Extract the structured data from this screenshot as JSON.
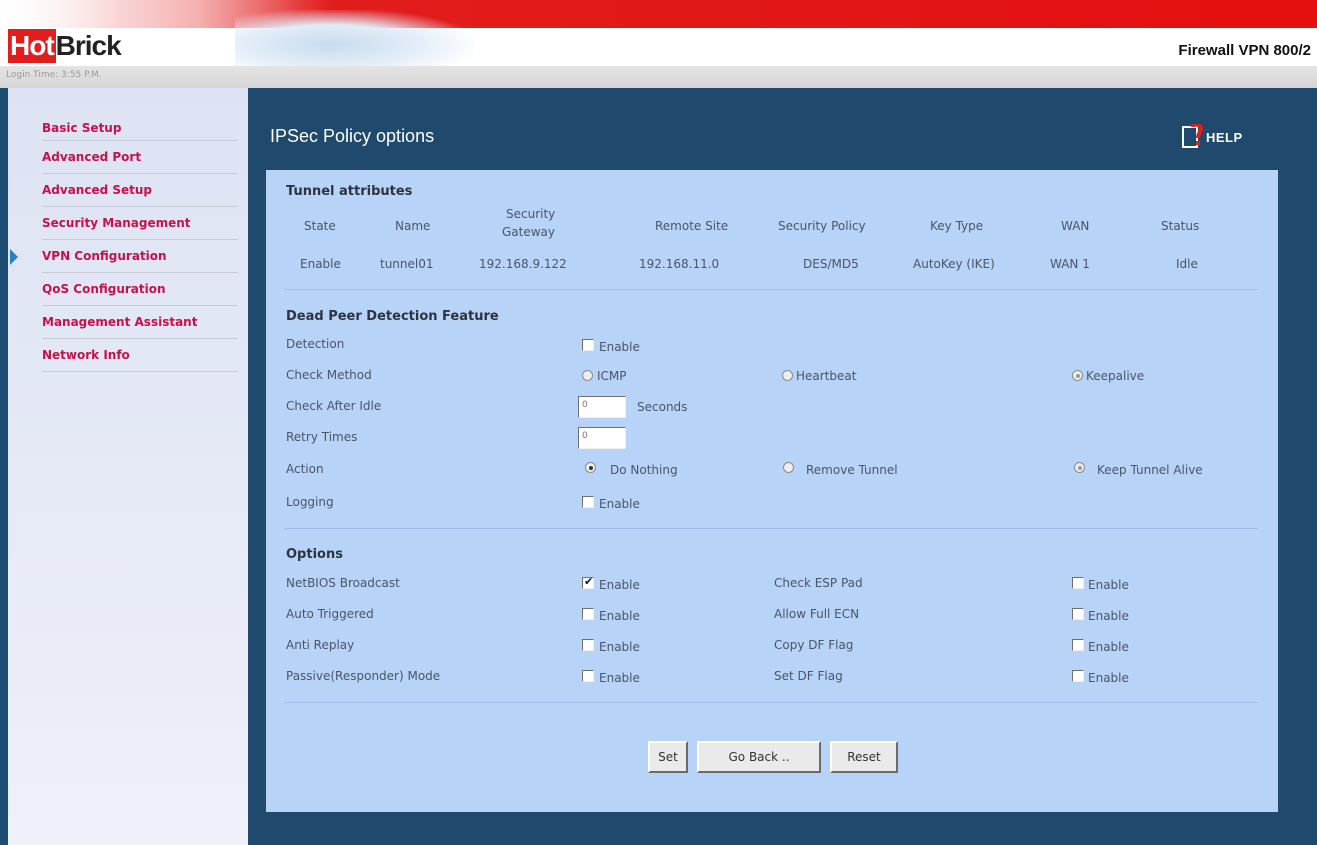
{
  "brand": {
    "logo_highlight": "Hot",
    "logo_rest": "Brick",
    "product": "Firewall VPN 800/2",
    "login_time": "Login Time: 3:55 P.M."
  },
  "sidebar": {
    "items": [
      {
        "label": "Basic Setup"
      },
      {
        "label": "Advanced Port"
      },
      {
        "label": "Advanced Setup"
      },
      {
        "label": "Security Management"
      },
      {
        "label": "VPN Configuration",
        "active": true
      },
      {
        "label": "QoS Configuration"
      },
      {
        "label": "Management Assistant"
      },
      {
        "label": "Network Info"
      }
    ]
  },
  "panel": {
    "title": "IPSec Policy options",
    "help_label": "HELP"
  },
  "tunnel": {
    "section_title": "Tunnel attributes",
    "headers": {
      "state": "State",
      "name": "Name",
      "gateway_line1": "Security",
      "gateway_line2": "Gateway",
      "remote": "Remote Site",
      "policy": "Security Policy",
      "key": "Key Type",
      "wan": "WAN",
      "status": "Status"
    },
    "row": {
      "state": "Enable",
      "name": "tunnel01",
      "gateway": "192.168.9.122",
      "remote": "192.168.11.0",
      "policy": "DES/MD5",
      "key": "AutoKey (IKE)",
      "wan": "WAN 1",
      "status": "Idle"
    }
  },
  "dpd": {
    "section_title": "Dead Peer Detection Feature",
    "detection_label": "Detection",
    "detection_option": "Enable",
    "detection_checked": false,
    "check_method_label": "Check Method",
    "method_options": [
      "ICMP",
      "Heartbeat",
      "Keepalive"
    ],
    "check_after_idle_label": "Check After Idle",
    "check_after_idle_value": "0",
    "seconds_label": "Seconds",
    "retry_times_label": "Retry Times",
    "retry_times_value": "0",
    "action_label": "Action",
    "action_options": [
      "Do Nothing",
      "Remove Tunnel",
      "Keep Tunnel Alive"
    ],
    "action_selected": "Do Nothing",
    "logging_label": "Logging",
    "logging_option": "Enable",
    "logging_checked": false
  },
  "options": {
    "section_title": "Options",
    "left": [
      {
        "label": "NetBIOS Broadcast",
        "option": "Enable",
        "checked": true
      },
      {
        "label": "Auto Triggered",
        "option": "Enable",
        "checked": false
      },
      {
        "label": "Anti Replay",
        "option": "Enable",
        "checked": false
      },
      {
        "label": "Passive(Responder) Mode",
        "option": "Enable",
        "checked": false
      }
    ],
    "right": [
      {
        "label": "Check ESP Pad",
        "option": "Enable",
        "checked": false
      },
      {
        "label": "Allow Full ECN",
        "option": "Enable",
        "checked": false
      },
      {
        "label": "Copy DF Flag",
        "option": "Enable",
        "checked": false
      },
      {
        "label": "Set DF Flag",
        "option": "Enable",
        "checked": false
      }
    ]
  },
  "buttons": {
    "set": "Set",
    "go_back": "Go Back ..",
    "reset": "Reset"
  },
  "colors": {
    "accent_red": "#e11d1d",
    "nav_text": "#c8104a",
    "main_bg": "#1f4a6d",
    "panel_bg": "#b7d3f7"
  }
}
